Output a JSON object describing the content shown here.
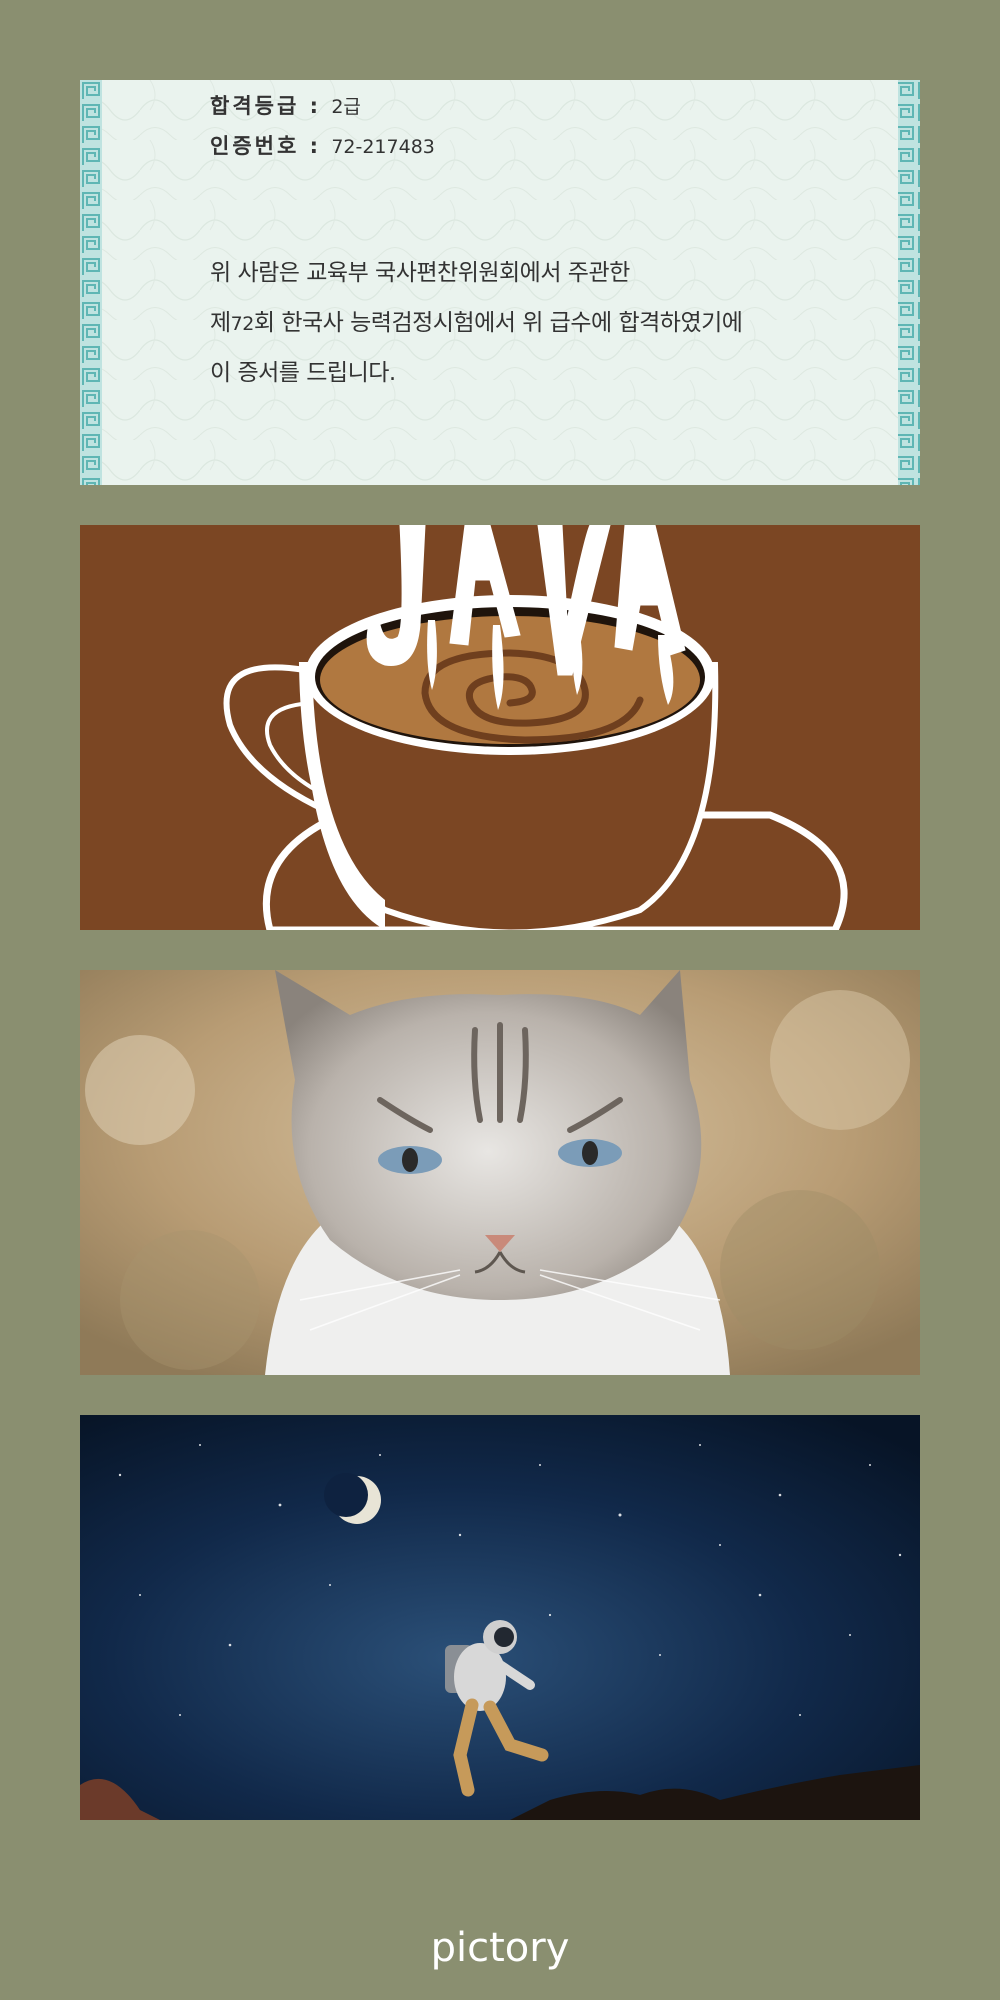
{
  "certificate": {
    "grade_label": "합격등급",
    "grade_sep": ":",
    "grade_value": "2급",
    "cert_no_label": "인증번호",
    "cert_no_sep": ":",
    "cert_no_value": "72-217483",
    "line1": "위  사람은 교육부 국사편찬위원회에서 주관한",
    "line2_prefix": "제",
    "line2_number": "72",
    "line2_rest": "회  한국사 능력검정시험에서 위 급수에 합격하였기에",
    "line3": "이 증서를 드립니다.",
    "colors": {
      "paper": "#eaf3ee",
      "border": "#8fcfcf",
      "text": "#333333"
    }
  },
  "coffee_panel": {
    "steam_text": "JAVA",
    "icon": "coffee-cup-icon",
    "colors": {
      "background": "#7b4623",
      "coffee": "#b07840",
      "outline": "#ffffff"
    }
  },
  "cat_panel": {
    "icon": "cat-photo"
  },
  "astronaut_panel": {
    "icon": "astronaut-night-sky-photo"
  },
  "brand": {
    "text": "pictory"
  },
  "colors": {
    "page_background": "#8a8f70"
  }
}
